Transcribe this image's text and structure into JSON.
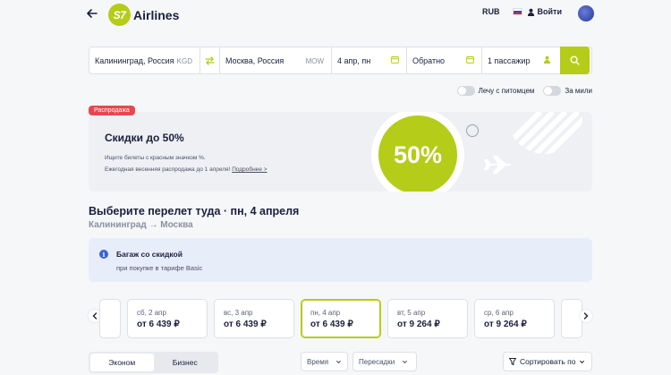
{
  "header": {
    "logo_mark": "S7",
    "logo_text": "Airlines",
    "currency": "RUB",
    "login": "Войти"
  },
  "search": {
    "from_city": "Калининград, Россия",
    "from_code": "KGD",
    "to_city": "Москва, Россия",
    "to_code": "MOW",
    "depart_date": "4 апр, пн",
    "return_date": "Обратно",
    "passengers": "1 пассажир"
  },
  "toggles": {
    "pet": "Лечу с питомцем",
    "miles": "За мили"
  },
  "promo": {
    "badge": "Распродажа",
    "title": "Скидки до 50%",
    "line1": "Ищите билеты с красным значком %.",
    "line2": "Ежегодная весенняя распродажа до 1 апреля!",
    "link": "Подробнее >",
    "circle": "50%"
  },
  "section": {
    "title": "Выберите перелет туда · пн, 4 апреля",
    "route": "Калининград → Москва"
  },
  "info": {
    "icon": "i",
    "title": "Багаж со скидкой",
    "subtitle": "при покупке в тарифе Basic"
  },
  "days": [
    {
      "date": "сб, 2 апр",
      "price": "от 6 439 ₽"
    },
    {
      "date": "вс, 3 апр",
      "price": "от 6 439 ₽"
    },
    {
      "date": "пн, 4 апр",
      "price": "от 6 439 ₽"
    },
    {
      "date": "вт, 5 апр",
      "price": "от 9 264 ₽"
    },
    {
      "date": "ср, 6 апр",
      "price": "от 9 264 ₽"
    }
  ],
  "tabs": {
    "economy": "Эконом",
    "business": "Бизнес"
  },
  "filters": {
    "time": "Время",
    "transfers": "Пересадки",
    "sort": "Сортировать по"
  },
  "colors": {
    "brand": "#b5cc18",
    "sale": "#e8474f",
    "info_accent": "#3b62d6"
  }
}
